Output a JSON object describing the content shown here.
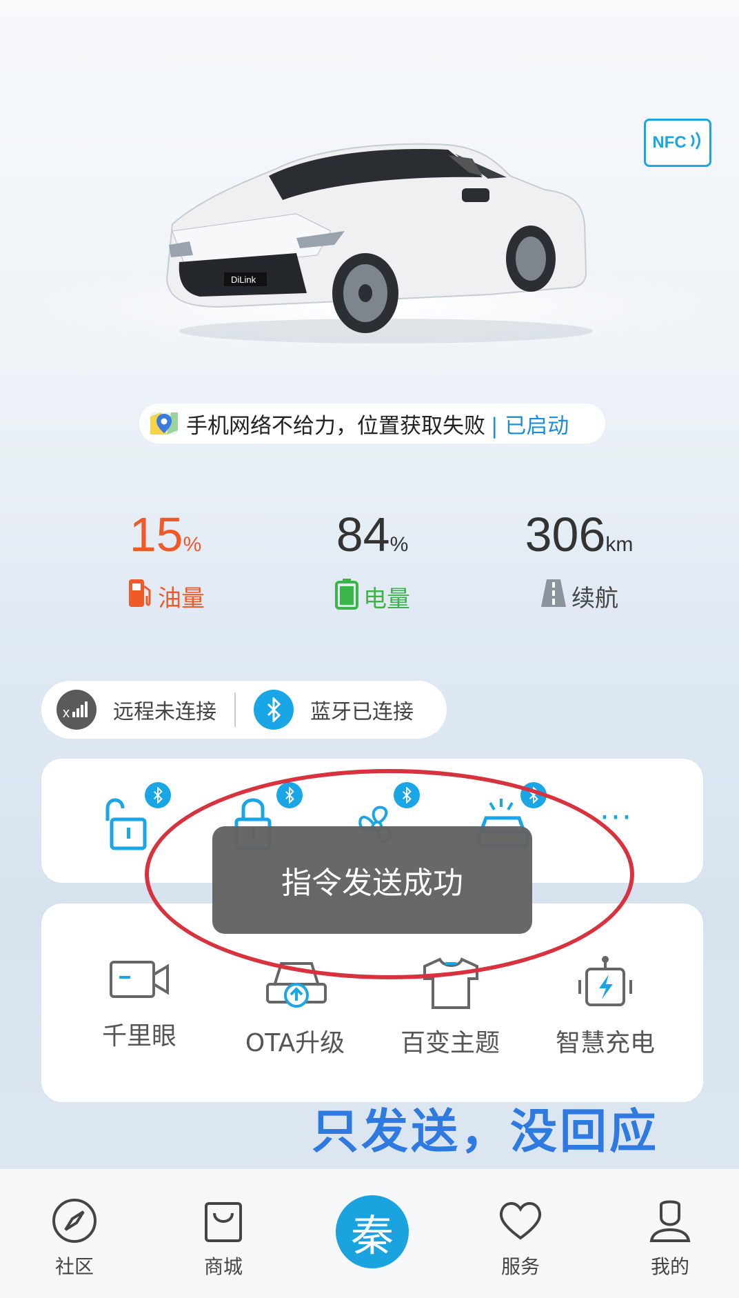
{
  "vehicle": {
    "nfc_label": "NFC"
  },
  "location": {
    "message": "手机网络不给力，位置获取失败",
    "status": "| 已启动"
  },
  "stats": [
    {
      "value": "15",
      "unit": "%",
      "label": "油量",
      "color": "#f05a28"
    },
    {
      "value": "84",
      "unit": "%",
      "label": "电量",
      "color": "#3bb54a"
    },
    {
      "value": "306",
      "unit": "km",
      "label": "续航",
      "color": "#333333"
    }
  ],
  "connection": {
    "remote": "远程未连接",
    "bluetooth": "蓝牙已连接"
  },
  "controls": [
    {
      "icon": "unlock-icon"
    },
    {
      "icon": "lock-icon"
    },
    {
      "icon": "fan-icon"
    },
    {
      "icon": "car-lights-icon"
    },
    {
      "icon": "more-icon",
      "text": "···"
    }
  ],
  "services": [
    {
      "label": "千里眼",
      "icon": "camera-icon"
    },
    {
      "label": "OTA升级",
      "icon": "ota-upgrade-icon"
    },
    {
      "label": "百变主题",
      "icon": "tshirt-icon"
    },
    {
      "label": "智慧充电",
      "icon": "charger-icon"
    }
  ],
  "toast": "指令发送成功",
  "annotation": "只发送，没回应",
  "nav": {
    "community": "社区",
    "mall": "商城",
    "center": "秦",
    "service": "服务",
    "mine": "我的"
  },
  "colors": {
    "accent": "#19a6e6",
    "fuel": "#f05a28",
    "battery": "#3bb54a",
    "annotation_ring": "#d8323f"
  }
}
